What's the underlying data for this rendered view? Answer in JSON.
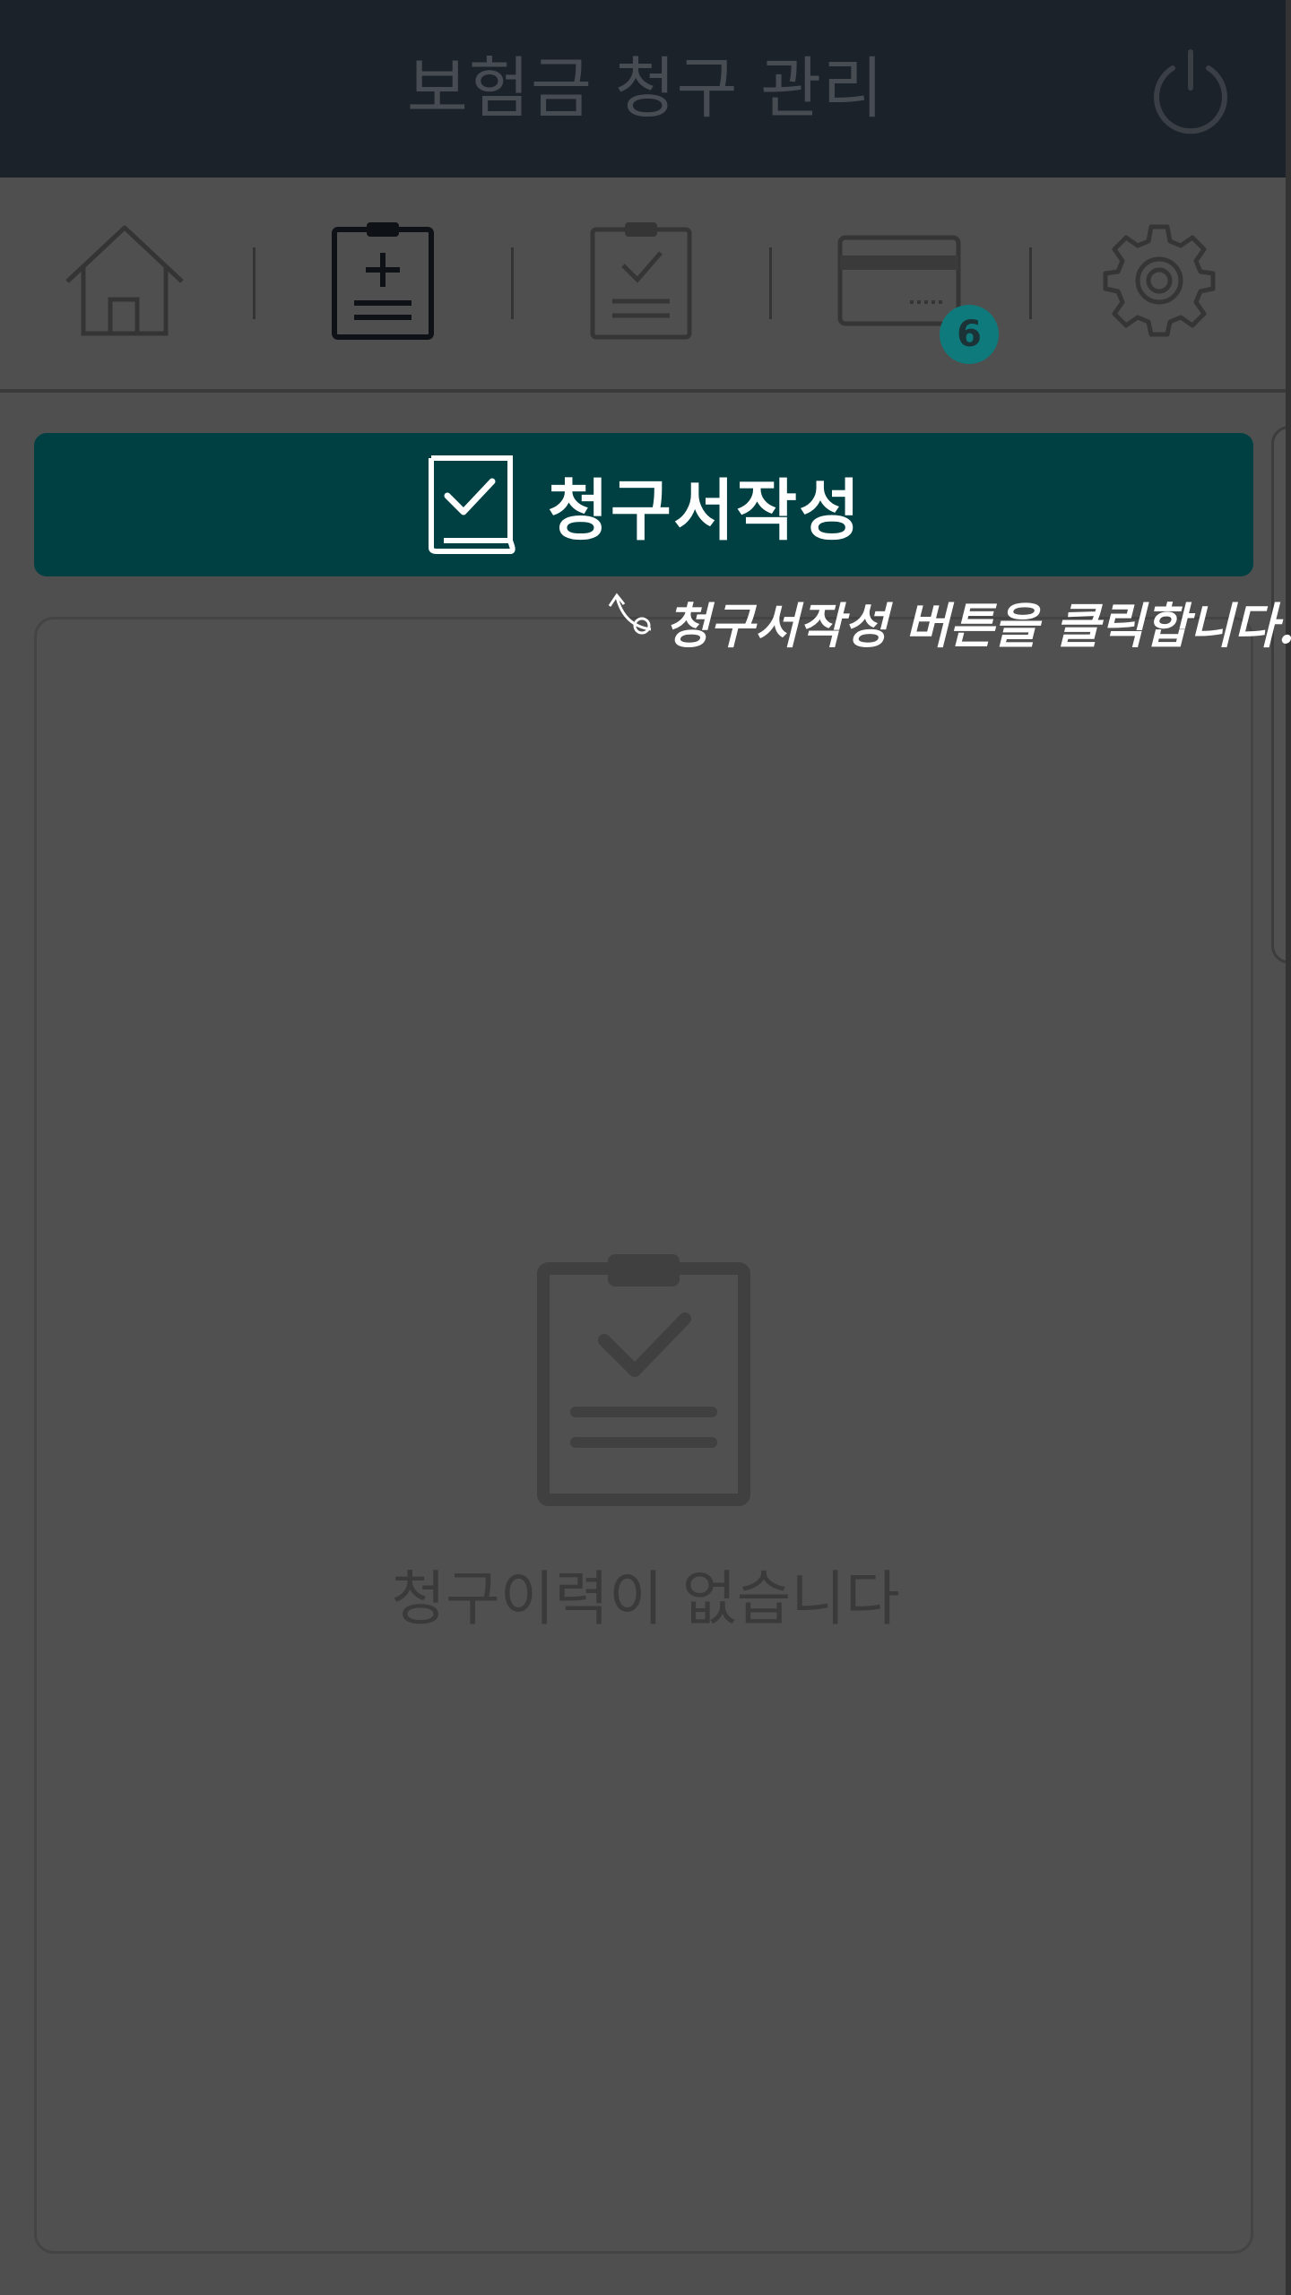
{
  "header": {
    "title": "보험금 청구 관리",
    "power_icon": "power-icon"
  },
  "tabs": [
    {
      "name": "home",
      "icon": "home-icon"
    },
    {
      "name": "claim-write",
      "icon": "clipboard-plus-icon",
      "active": true
    },
    {
      "name": "claim-history",
      "icon": "clipboard-check-icon"
    },
    {
      "name": "card",
      "icon": "credit-card-icon",
      "badge": "6"
    },
    {
      "name": "settings",
      "icon": "gear-icon"
    }
  ],
  "primary_button": {
    "label": "청구서작성",
    "icon": "document-check-icon"
  },
  "hint": {
    "text": "청구서작성 버튼을 클릭합니다.",
    "icon": "arrow-icon"
  },
  "empty_state": {
    "message": "청구이력이 없습니다",
    "icon": "clipboard-check-icon"
  },
  "colors": {
    "header_bg": "#1c2229",
    "overlay_bg": "#4f4f4f",
    "primary": "#004043",
    "badge": "#0f7a7c"
  }
}
